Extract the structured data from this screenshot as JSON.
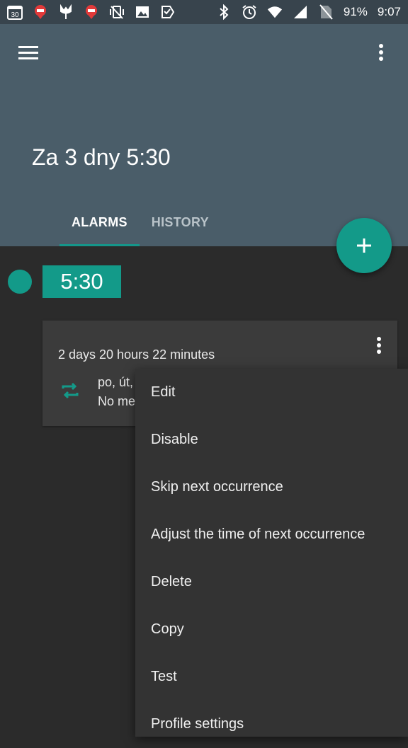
{
  "status_bar": {
    "left_icons": [
      "calendar-30-icon",
      "maps-pin-icon",
      "tulip-icon",
      "maps-pin-icon",
      "vibrate-icon",
      "image-icon",
      "check-tag-icon"
    ],
    "calendar_day": "30",
    "battery": "91%",
    "time": "9:07"
  },
  "header": {
    "title": "Za 3 dny 5:30",
    "tabs": [
      {
        "label": "ALARMS",
        "active": true
      },
      {
        "label": "HISTORY",
        "active": false
      }
    ]
  },
  "alarm": {
    "time": "5:30",
    "countdown": "2 days 20 hours 22 minutes",
    "days": "po, út,",
    "note": "No me"
  },
  "menu": {
    "items": [
      {
        "label": "Edit"
      },
      {
        "label": "Disable"
      },
      {
        "label": "Skip next occurrence"
      },
      {
        "label": "Adjust the time of next occurrence"
      },
      {
        "label": "Delete"
      },
      {
        "label": "Copy"
      },
      {
        "label": "Test"
      },
      {
        "label": "Profile settings"
      }
    ]
  },
  "colors": {
    "accent": "#139a89",
    "header": "#4a5d69",
    "background": "#2b2b2b"
  }
}
